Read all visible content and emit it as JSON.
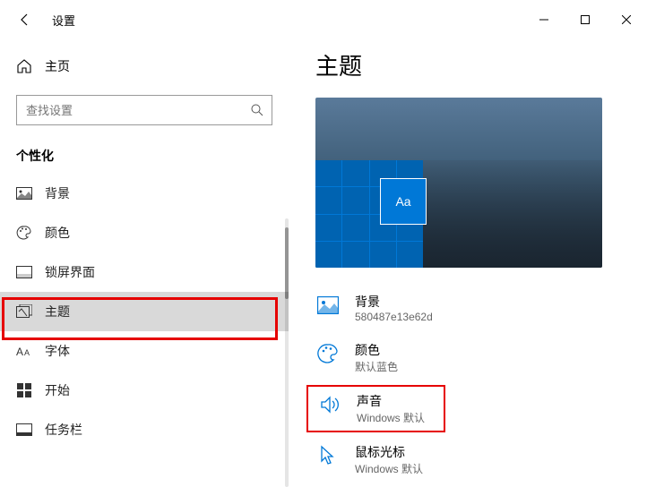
{
  "titlebar": {
    "app_title": "设置"
  },
  "sidebar": {
    "home_label": "主页",
    "search_placeholder": "查找设置",
    "section_label": "个性化",
    "items": [
      {
        "label": "背景"
      },
      {
        "label": "颜色"
      },
      {
        "label": "锁屏界面"
      },
      {
        "label": "主题"
      },
      {
        "label": "字体"
      },
      {
        "label": "开始"
      },
      {
        "label": "任务栏"
      }
    ]
  },
  "content": {
    "page_title": "主题",
    "preview_aa": "Aa",
    "settings": [
      {
        "title": "背景",
        "sub": "580487e13e62d"
      },
      {
        "title": "颜色",
        "sub": "默认蓝色"
      },
      {
        "title": "声音",
        "sub": "Windows 默认"
      },
      {
        "title": "鼠标光标",
        "sub": "Windows 默认"
      }
    ]
  }
}
